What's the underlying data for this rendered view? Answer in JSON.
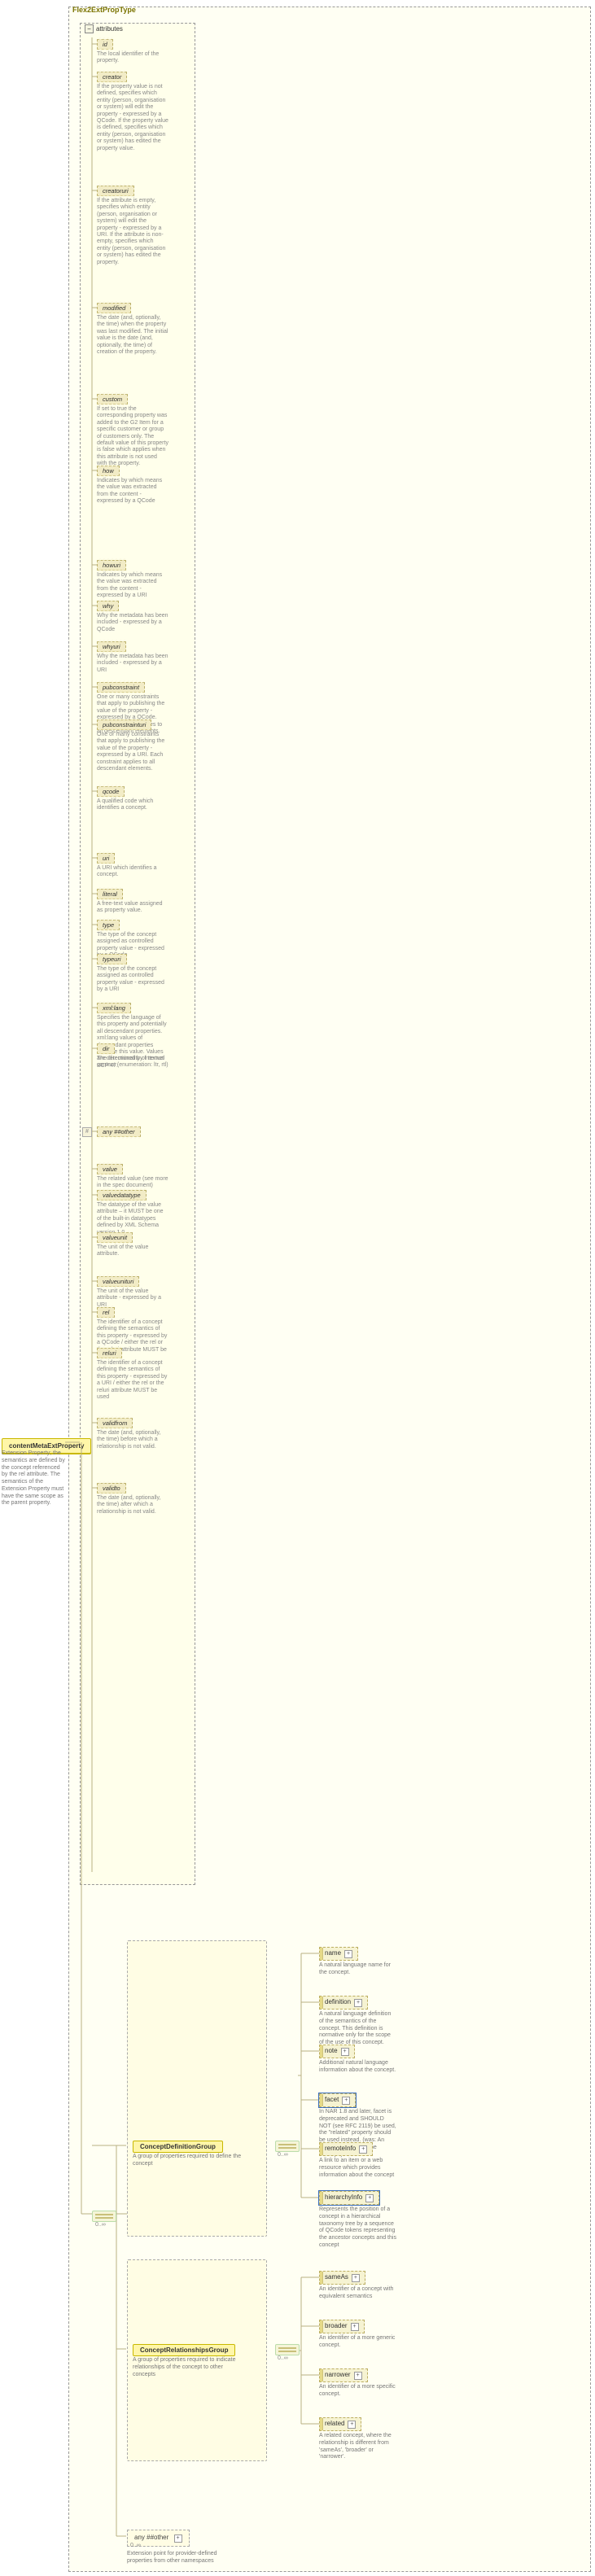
{
  "pane": {
    "title": "Flex2ExtPropType"
  },
  "attributes_label": "attributes",
  "root": {
    "label": "contentMetaExtProperty",
    "desc": "Extension Property; the semantics are defined by the concept referenced by the rel attribute. The semantics of the Extension Property must have the same scope as the parent property."
  },
  "attrs": [
    {
      "name": "id",
      "opt": true,
      "desc": "The local identifier of the property."
    },
    {
      "name": "creator",
      "opt": true,
      "desc": "If the property value is not defined, specifies which entity (person, organisation or system) will edit the property - expressed by a QCode. If the property value is defined, specifies which entity (person, organisation or system) has edited the property value."
    },
    {
      "name": "creatoruri",
      "opt": true,
      "desc": "If the attribute is empty, specifies which entity (person, organisation or system) will edit the property - expressed by a URI. If the attribute is non-empty, specifies which entity (person, organisation or system) has edited the property."
    },
    {
      "name": "modified",
      "opt": true,
      "desc": "The date (and, optionally, the time) when the property was last modified. The initial value is the date (and, optionally, the time) of creation of the property."
    },
    {
      "name": "custom",
      "opt": true,
      "desc": "If set to true the corresponding property was added to the G2 Item for a specific customer or group of customers only. The default value of this property is false which applies when this attribute is not used with the property."
    },
    {
      "name": "how",
      "opt": true,
      "desc": "Indicates by which means the value was extracted from the content - expressed by a QCode"
    },
    {
      "name": "howuri",
      "opt": true,
      "desc": "Indicates by which means the value was extracted from the content - expressed by a URI"
    },
    {
      "name": "why",
      "opt": true,
      "desc": "Why the metadata has been included - expressed by a QCode"
    },
    {
      "name": "whyuri",
      "opt": true,
      "desc": "Why the metadata has been included - expressed by a URI"
    },
    {
      "name": "pubconstraint",
      "opt": true,
      "desc": "One or many constraints that apply to publishing the value of the property - expressed by a QCode. Each constraint applies to all descendant elements."
    },
    {
      "name": "pubconstrainturi",
      "opt": true,
      "desc": "One or many constraints that apply to publishing the value of the property - expressed by a URI. Each constraint applies to all descendant elements."
    },
    {
      "name": "qcode",
      "opt": true,
      "desc": "A qualified code which identifies a concept."
    },
    {
      "name": "uri",
      "opt": true,
      "desc": "A URI which identifies a concept."
    },
    {
      "name": "literal",
      "opt": true,
      "desc": "A free-text value assigned as property value."
    },
    {
      "name": "type",
      "opt": true,
      "desc": "The type of the concept assigned as controlled property value - expressed by a QCode"
    },
    {
      "name": "typeuri",
      "opt": true,
      "desc": "The type of the concept assigned as controlled property value - expressed by a URI"
    },
    {
      "name": "xml:lang",
      "opt": true,
      "desc": "Specifies the language of this property and potentially all descendant properties. xml:lang values of descendant properties override this value. Values are determined by Internet BCP 47."
    },
    {
      "name": "dir",
      "opt": true,
      "desc": "The directionality of textual content (enumeration: ltr, rtl)"
    },
    {
      "name": "any ##other",
      "opt": true,
      "hash": true,
      "desc": ""
    },
    {
      "name": "value",
      "opt": true,
      "desc": "The related value (see more in the spec document)"
    },
    {
      "name": "valuedatatype",
      "opt": true,
      "desc": "The datatype of the value attribute – it MUST be one of the built-in datatypes defined by XML Schema version 1.0."
    },
    {
      "name": "valueunit",
      "opt": true,
      "desc": "The unit of the value attribute."
    },
    {
      "name": "valueunituri",
      "opt": true,
      "desc": "The unit of the value attribute - expressed by a URI"
    },
    {
      "name": "rel",
      "opt": true,
      "desc": "The identifier of a concept defining the semantics of this property - expressed by a QCode / either the rel or the reluri attribute MUST be used"
    },
    {
      "name": "reluri",
      "opt": true,
      "desc": "The identifier of a concept defining the semantics of this property - expressed by a URI / either the rel or the reluri attribute MUST be used"
    },
    {
      "name": "validfrom",
      "opt": true,
      "desc": "The date (and, optionally, the time) before which a relationship is not valid."
    },
    {
      "name": "validto",
      "opt": true,
      "desc": "The date (and, optionally, the time) after which a relationship is not valid."
    }
  ],
  "groups": {
    "def": {
      "title": "ConceptDefinitionGroup",
      "desc": "A group of properties required to define the concept",
      "leaves": [
        {
          "name": "name",
          "opt": true,
          "desc": "A natural language name for the concept."
        },
        {
          "name": "definition",
          "opt": true,
          "desc": "A natural language definition of the semantics of the concept. This definition is normative only for the scope of the use of this concept."
        },
        {
          "name": "note",
          "opt": true,
          "desc": "Additional natural language information about the concept."
        },
        {
          "name": "facet",
          "opt": true,
          "selected": true,
          "desc": "In NAR 1.8 and later, facet is deprecated and SHOULD NOT (see RFC 2119) be used, the \"related\" property should be used instead. (was: An intrinsic property of the concept.)"
        },
        {
          "name": "remoteInfo",
          "opt": true,
          "desc": "A link to an item or a web resource which provides information about the concept"
        },
        {
          "name": "hierarchyInfo",
          "opt": true,
          "selected": true,
          "desc": "Represents the position of a concept in a hierarchical taxonomy tree by a sequence of QCode tokens representing the ancestor concepts and this concept"
        }
      ]
    },
    "rel": {
      "title": "ConceptRelationshipsGroup",
      "desc": "A group of properties required to indicate relationships of the concept to other concepts",
      "leaves": [
        {
          "name": "sameAs",
          "opt": true,
          "desc": "An identifier of a concept with equivalent semantics"
        },
        {
          "name": "broader",
          "opt": true,
          "desc": "An identifier of a more generic concept."
        },
        {
          "name": "narrower",
          "opt": true,
          "desc": "An identifier of a more specific concept."
        },
        {
          "name": "related",
          "opt": true,
          "desc": "A related concept, where the relationship is different from 'sameAs', 'broader' or 'narrower'."
        }
      ]
    }
  },
  "any_element": {
    "label": "any ##other",
    "desc": "Extension point for provider-defined properties from other namespaces"
  },
  "occ": {
    "zero_inf": "0..∞"
  }
}
